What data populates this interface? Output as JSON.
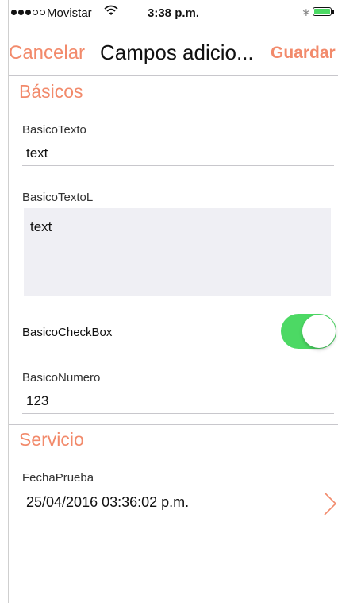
{
  "status_bar": {
    "carrier": "Movistar",
    "time": "3:38 p.m.",
    "bluetooth_icon": "bluetooth-icon",
    "battery_icon": "battery-icon",
    "signal_icon": "signal-dots-icon",
    "wifi_icon": "wifi-icon"
  },
  "nav": {
    "cancel_label": "Cancelar",
    "title": "Campos adicio...",
    "save_label": "Guardar"
  },
  "colors": {
    "accent": "#f28a6b",
    "toggle_on": "#4cd964",
    "separator": "#c8c7cc",
    "textarea_bg": "#efeff4"
  },
  "sections": [
    {
      "header": "Básicos",
      "fields": [
        {
          "label": "BasicoTexto",
          "value": "text"
        },
        {
          "label": "BasicoTextoL",
          "value": "text"
        },
        {
          "label": "BasicoCheckBox",
          "value": true
        },
        {
          "label": "BasicoNumero",
          "value": "123"
        }
      ]
    },
    {
      "header": "Servicio",
      "fields": [
        {
          "label": "FechaPrueba",
          "value": "25/04/2016 03:36:02 p.m."
        }
      ]
    }
  ]
}
